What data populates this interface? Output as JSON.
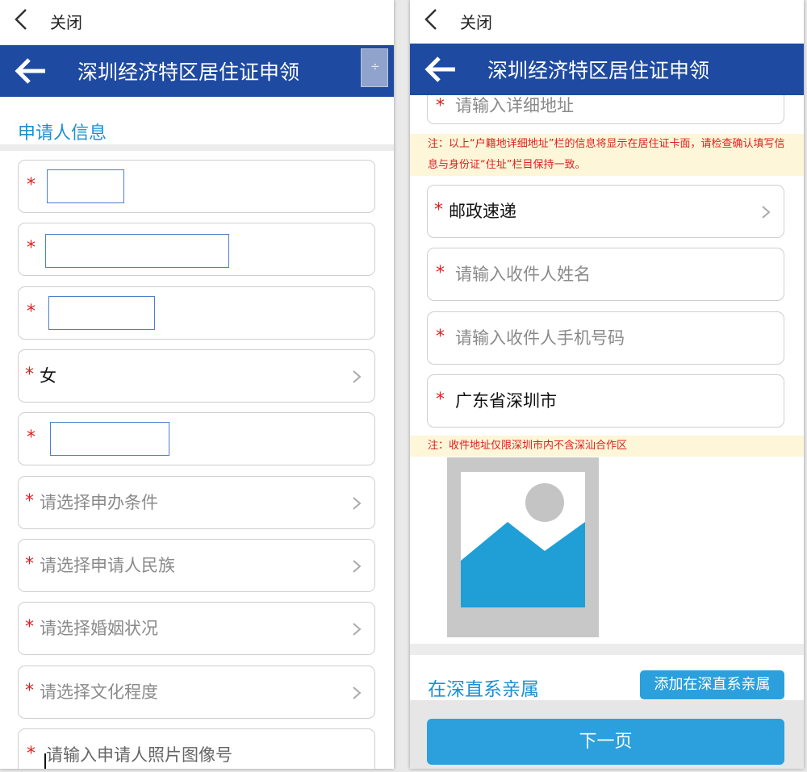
{
  "topbar": {
    "close_label": "关闭"
  },
  "header": {
    "title": "深圳经济特区居住证申领",
    "menu_icon_glyph": "÷"
  },
  "left": {
    "section_title": "申请人信息",
    "fields": [
      {
        "text": "",
        "type": "redacted"
      },
      {
        "text": "",
        "type": "redacted"
      },
      {
        "text": "",
        "type": "redacted"
      },
      {
        "text": "女",
        "type": "value",
        "chevron": true
      },
      {
        "text": "",
        "type": "redacted"
      },
      {
        "text": "请选择申办条件",
        "type": "placeholder",
        "chevron": true
      },
      {
        "text": "请选择申请人民族",
        "type": "placeholder",
        "chevron": true
      },
      {
        "text": "请选择婚姻状况",
        "type": "placeholder",
        "chevron": true
      },
      {
        "text": "请选择文化程度",
        "type": "placeholder",
        "chevron": true
      },
      {
        "text": "请输入申请人照片图像号",
        "type": "input-placeholder"
      }
    ]
  },
  "right": {
    "partial_field": "请输入详细地址",
    "note_1": "注：以上“户籍地详细地址”栏的信息将显示在居住证卡面，请检查确认填写信息与身份证“住址”栏目保持一致。",
    "delivery_method": "邮政速递",
    "recipient_name_placeholder": "请输入收件人姓名",
    "recipient_phone_placeholder": "请输入收件人手机号码",
    "recipient_city": "广东省深圳市",
    "note_2": "注：收件地址仅限深圳市内不含深汕合作区",
    "kin_section_title": "在深直系亲属",
    "add_kin_button": "添加在深直系亲属",
    "next_button": "下一页"
  },
  "colors": {
    "title_bar": "#1e4aa1",
    "accent_blue": "#2ba0dd",
    "section_blue": "#1d8fd1",
    "required_red": "#e02020",
    "note_bg": "#fdf6d8"
  }
}
